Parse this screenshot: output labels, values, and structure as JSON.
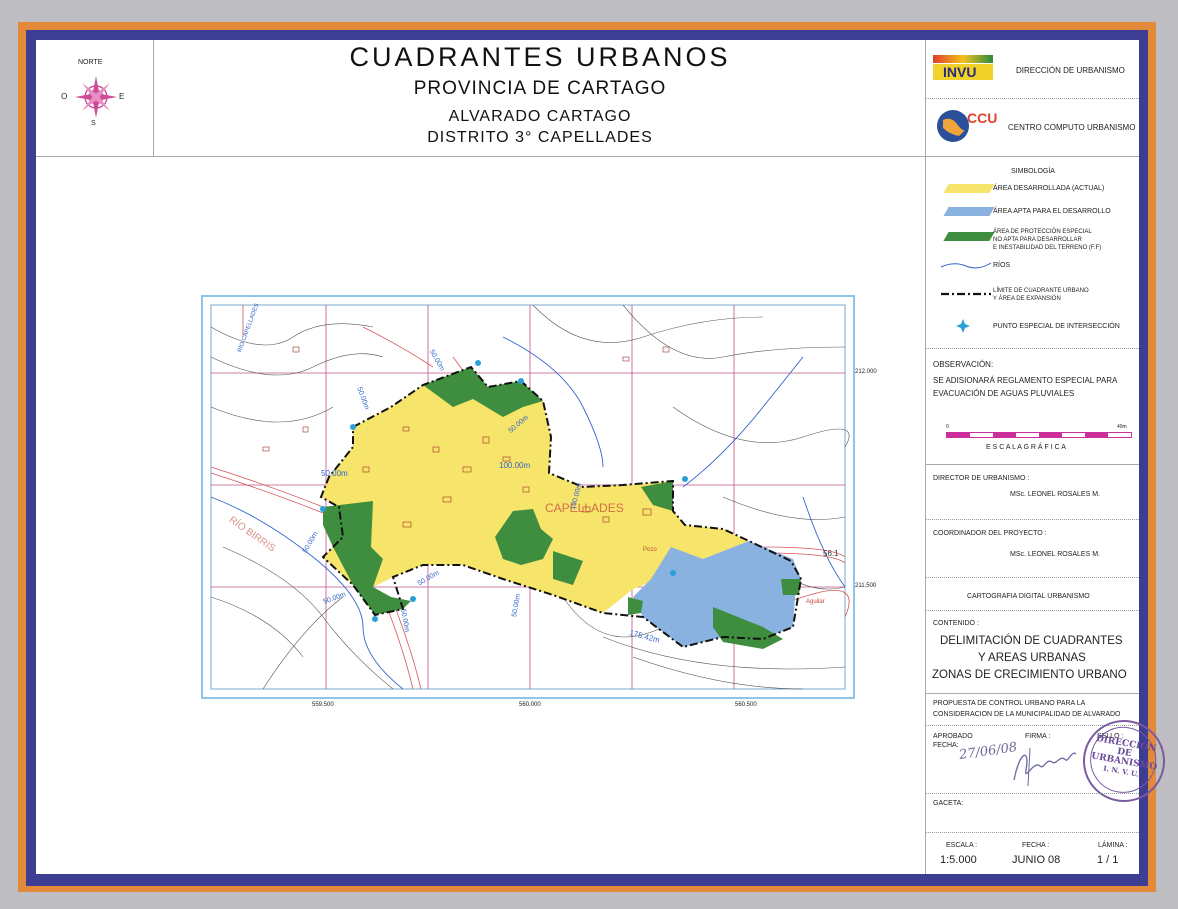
{
  "header": {
    "title": "CUADRANTES   URBANOS",
    "province": "PROVINCIA  DE  CARTAGO",
    "canton": "ALVARADO  CARTAGO",
    "district": "DISTRITO  3°  CAPELLADES"
  },
  "compass": {
    "north": "NORTE",
    "south": "S",
    "east": "E",
    "west": "O"
  },
  "agencies": [
    {
      "logo": "INVU",
      "name": "DIRECCIÓN  DE  URBANISMO"
    },
    {
      "logo": "CCU",
      "name": "CENTRO  COMPUTO  URBANISMO"
    }
  ],
  "legend": {
    "title": "SIMBOLOGÍA",
    "items": [
      {
        "label": "ÁREA DESARROLLADA (ACTUAL)",
        "color": "#f7e46a",
        "symbol": "fill"
      },
      {
        "label": "ÁREA APTA PARA EL DESARROLLO",
        "color": "#8ab2e0",
        "symbol": "fill"
      },
      {
        "label_lines": [
          "ÁREA DE PROTECCIÓN ESPECIAL",
          "NO APTA PARA DESARROLLAR",
          "E INESTABILIDAD DEL TERRENO (F.F)"
        ],
        "color": "#3f8e3f",
        "symbol": "fill"
      },
      {
        "label": "RÍOS",
        "color": "#3366cc",
        "symbol": "river-line"
      },
      {
        "label_lines": [
          "LÍMITE DE CUADRANTE URBANO",
          "Y ÁREA DE EXPANSIÓN"
        ],
        "color": "#111111",
        "symbol": "dash-dot-line"
      },
      {
        "label": "PUNTO ESPECIAL DE INTERSECCIÓN",
        "color": "#2ba0d8",
        "symbol": "point-icon"
      }
    ]
  },
  "observation": {
    "heading": "OBSERVACIÓN:",
    "lines": [
      "SE ADISIONARÁ REGLAMENTO ESPECIAL PARA",
      "EVACUACIÓN DE AGUAS PLUVIALES"
    ]
  },
  "scale_bar": {
    "min": "0",
    "max": "40m",
    "label": "E S C A L A    G R Á F I C A",
    "color": "#cc2f9a"
  },
  "director": {
    "heading": "DIRECTOR DE URBANISMO :",
    "name": "MSc. LEONEL ROSALES M."
  },
  "coordinator": {
    "heading": "COORDINADOR DEL PROYECTO :",
    "name": "MSc. LEONEL ROSALES M."
  },
  "cartography": "CARTOGRAFIA DIGITAL URBANISMO",
  "content": {
    "heading": "CONTENIDO :",
    "lines": [
      "DELIMITACIÓN DE CUADRANTES",
      "Y AREAS URBANAS",
      "ZONAS DE CRECIMIENTO URBANO"
    ]
  },
  "proposal": [
    "PROPUESTA DE CONTROL URBANO PARA LA",
    "CONSIDERACION DE LA MUNICIPALIDAD DE ALVARADO"
  ],
  "approval": {
    "approved_label": "APROBADO",
    "date_label": "FECHA:",
    "date_value": "27/06/08",
    "signature_label": "FIRMA :",
    "seal_label": "SELLO :",
    "seal_text": [
      "DIRECCION",
      "DE",
      "URBANISMO",
      "I. N. V. U."
    ]
  },
  "gaceta": "GACETA:",
  "footer": {
    "scale_label": "ESCALA :",
    "scale_value": "1:5.000",
    "date_label": "FECHA :",
    "date_value": "JUNIO 08",
    "sheet_label": "LÁMINA :",
    "sheet_value": "1 / 1"
  },
  "map": {
    "y_coords": [
      "212.000",
      "211.500"
    ],
    "x_coords": [
      "559.500",
      "560.000",
      "560.500"
    ],
    "town_label": "CAPELLADES",
    "river_labels": [
      "RÍO BIRRIS",
      "RÍO CAPELLADES"
    ],
    "place_labels": [
      "Pozo",
      "Aguilar"
    ],
    "distance_labels": [
      "50.00m",
      "50.00m",
      "50.00m",
      "100.00m",
      "100.00m",
      "50.00m",
      "50.00m",
      "50.00m",
      "50.00m",
      "175.42m",
      "50.00m",
      "56.1",
      "50.00m"
    ],
    "colors": {
      "developed": "#f7e46a",
      "apt": "#8ab2e0",
      "protection": "#3f8e3f",
      "grid": "#c0508a",
      "roads": "#d65555",
      "contours": "#555555",
      "rivers": "#3366cc"
    }
  }
}
